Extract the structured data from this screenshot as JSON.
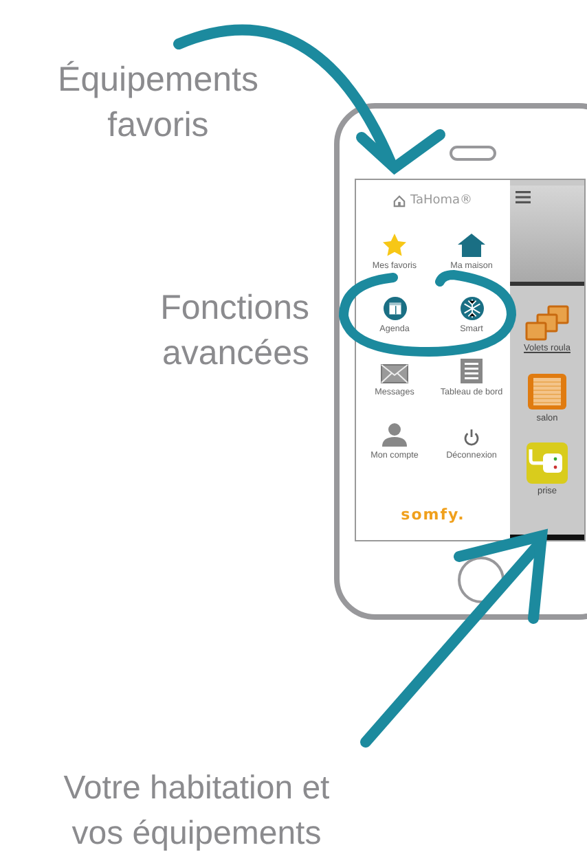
{
  "annotations": [
    {
      "text": "Équipements favoris"
    },
    {
      "text": "Fonctions avancées"
    },
    {
      "text": "Votre habitation et vos équipements"
    }
  ],
  "app": {
    "logo": "TaHoma®",
    "menu_items": [
      {
        "label": "Mes favoris"
      },
      {
        "label": "Ma maison"
      },
      {
        "label": "Agenda"
      },
      {
        "label": "Smart"
      },
      {
        "label": "Messages"
      },
      {
        "label": "Tableau de bord"
      },
      {
        "label": "Mon compte"
      },
      {
        "label": "Déconnexion"
      }
    ],
    "brand": "somfy.",
    "tiles": [
      {
        "label": "Volets roula"
      },
      {
        "label": "salon"
      },
      {
        "label": "prise"
      }
    ]
  }
}
